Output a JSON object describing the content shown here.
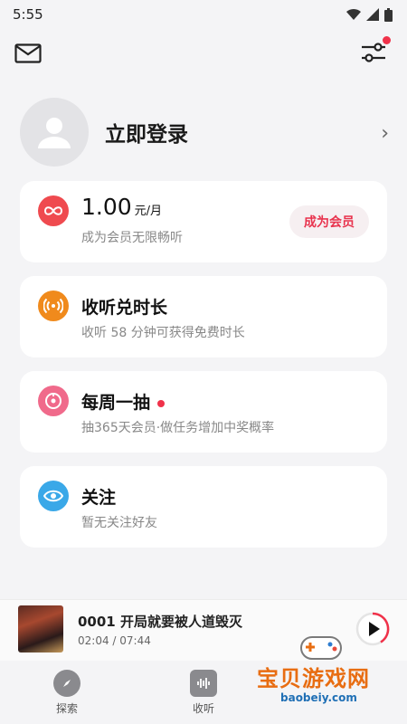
{
  "status_bar": {
    "time": "5:55"
  },
  "profile": {
    "login_label": "立即登录"
  },
  "membership": {
    "price": "1.00",
    "unit": "元/月",
    "subtitle": "成为会员无限畅听",
    "button": "成为会员"
  },
  "cards": [
    {
      "title": "收听兑时长",
      "subtitle": "收听 58 分钟可获得免费时长"
    },
    {
      "title": "每周一抽",
      "subtitle": "抽365天会员·做任务增加中奖概率"
    },
    {
      "title": "关注",
      "subtitle": "暂无关注好友"
    }
  ],
  "player": {
    "title": "0001 开局就要被人道毁灭",
    "time": "02:04 / 07:44"
  },
  "tabs": [
    {
      "label": "探索"
    },
    {
      "label": "收听"
    }
  ],
  "watermark": {
    "text": "宝贝游戏网",
    "url": "baobeiy.com"
  },
  "colors": {
    "accent_red": "#f0324a",
    "membership_icon": "#ef4a4f",
    "listen_icon": "#f08a1c",
    "draw_icon": "#f06a8b",
    "follow_icon": "#3aa8e8"
  }
}
